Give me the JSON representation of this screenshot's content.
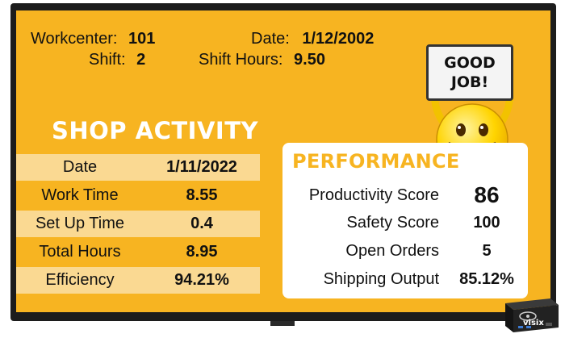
{
  "header": {
    "workcenter_label": "Workcenter:",
    "workcenter_value": "101",
    "shift_label": "Shift:",
    "shift_value": "2",
    "date_label": "Date:",
    "date_value": "1/12/2002",
    "shift_hours_label": "Shift Hours:",
    "shift_hours_value": "9.50"
  },
  "sign": {
    "line1": "GOOD",
    "line2": "JOB!"
  },
  "shop_activity": {
    "title": "SHOP ACTIVITY",
    "rows": [
      {
        "label": "Date",
        "value": "1/11/2022"
      },
      {
        "label": "Work Time",
        "value": "8.55"
      },
      {
        "label": "Set Up Time",
        "value": "0.4"
      },
      {
        "label": "Total Hours",
        "value": "8.95"
      },
      {
        "label": "Efficiency",
        "value": "94.21%"
      }
    ]
  },
  "performance": {
    "title": "PERFORMANCE",
    "rows": [
      {
        "label": "Productivity Score",
        "value": "86"
      },
      {
        "label": "Safety Score",
        "value": "100"
      },
      {
        "label": "Open Orders",
        "value": "5"
      },
      {
        "label": "Shipping Output",
        "value": "85.12%"
      }
    ]
  },
  "device": {
    "brand": "visix"
  },
  "colors": {
    "background": "#f7b421",
    "row_highlight": "#fad992",
    "accent_title": "#f7b421",
    "card": "#ffffff"
  }
}
